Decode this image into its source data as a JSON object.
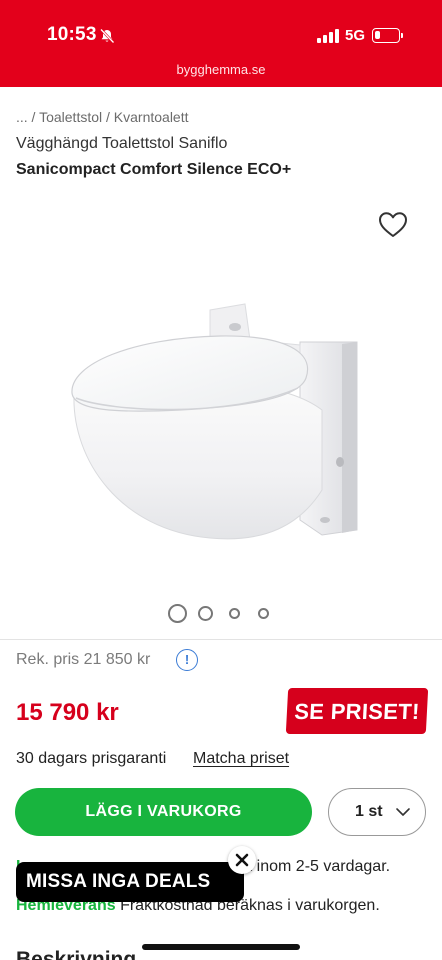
{
  "status_bar": {
    "time": "10:53",
    "network": "5G",
    "battery_level": 0.25,
    "icons": [
      "bell-off-icon",
      "signal-icon",
      "battery-icon"
    ]
  },
  "browser": {
    "url": "bygghemma.se"
  },
  "breadcrumb": {
    "text": "... / Toalettstol / Kvarntoalett"
  },
  "product": {
    "brand_line": "Vägghängd Toalettstol Saniflo",
    "name": "Sanicompact Comfort Silence ECO+",
    "carousel_index": 1,
    "carousel_count": 4
  },
  "pricing": {
    "recommended": "Rek. pris 21 850 kr",
    "info_glyph": "!",
    "price": "15 790 kr",
    "se_priset": "SE PRISET!"
  },
  "guarantee": {
    "text": "30 dagars prisgaranti",
    "match_link": "Matcha priset"
  },
  "cart": {
    "add_label": "LÄGG I VARUKORG",
    "quantity": "1 st"
  },
  "delivery": {
    "line1_prefix": "L",
    "line1_text": "t inom 2-5 vardagar.",
    "line2_label": "Hemleverans",
    "line2_text": " Fraktkostnad beräknas i varukorgen."
  },
  "deals_banner": {
    "text": "MISSA INGA DEALS"
  },
  "section": {
    "heading": "Beskrivning"
  },
  "colors": {
    "brand_red": "#e3001b",
    "price_red": "#d6001c",
    "cta_green": "#18b43e",
    "link_blue": "#3a7bd5"
  }
}
